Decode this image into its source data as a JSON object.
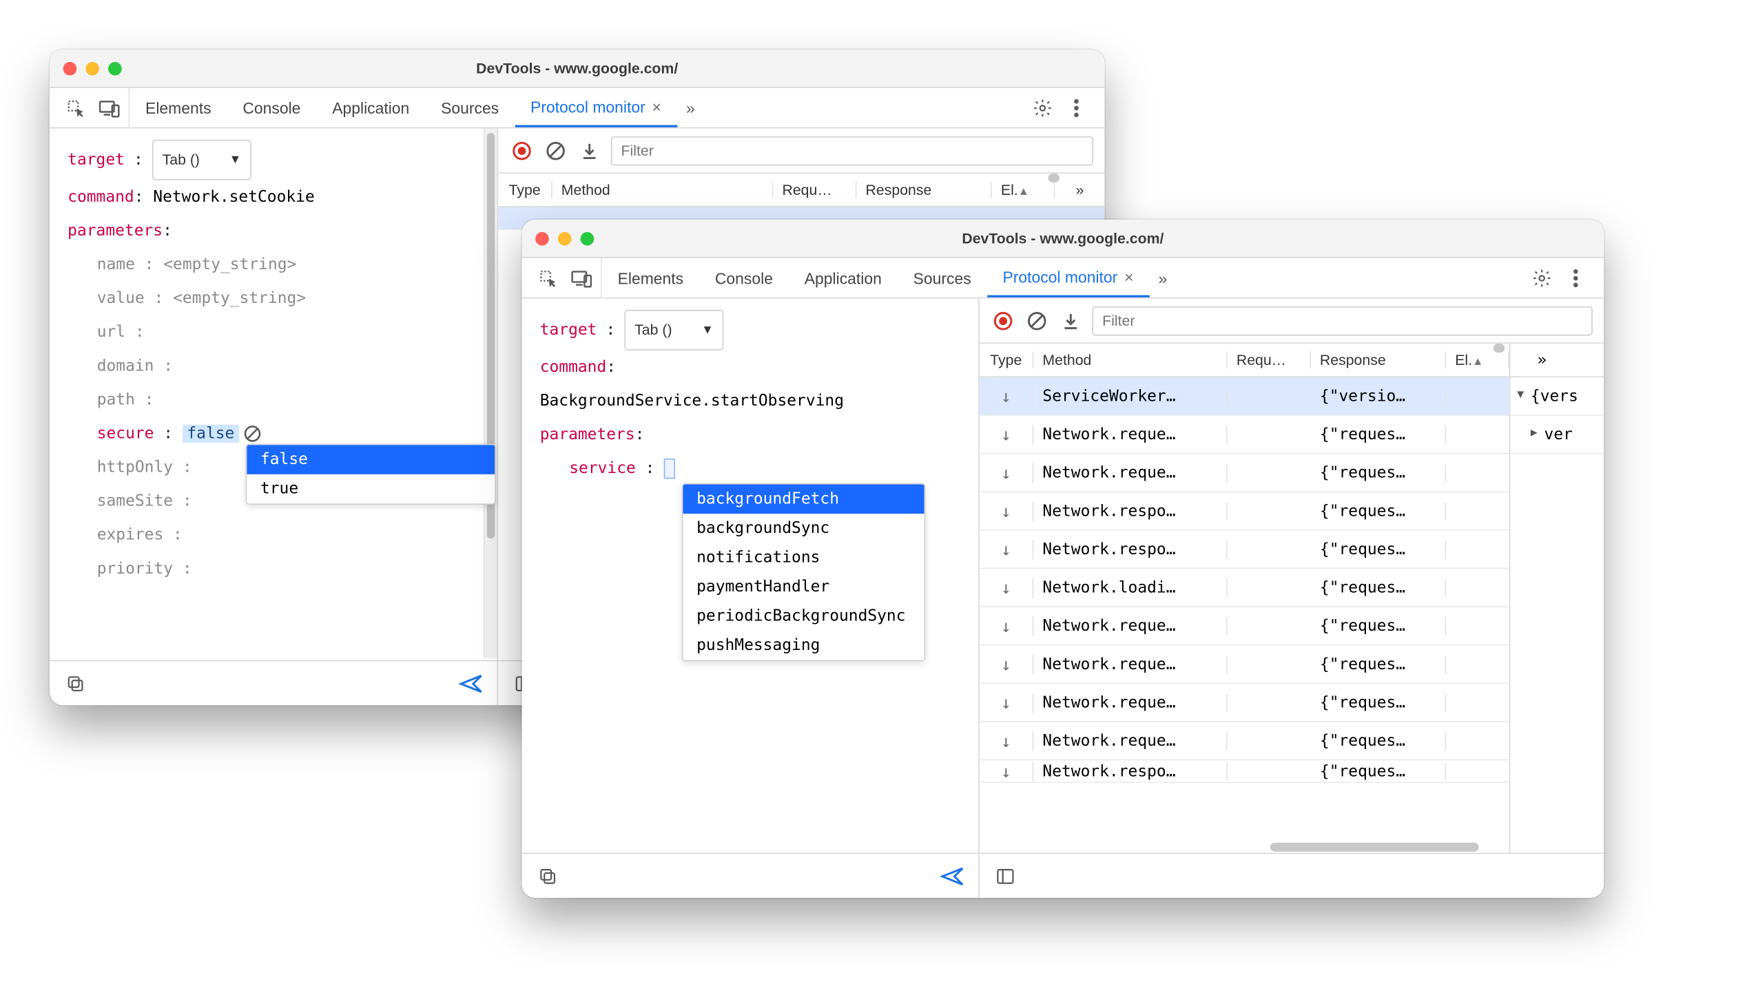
{
  "windowA": {
    "title": "DevTools - www.google.com/",
    "tabs": [
      "Elements",
      "Console",
      "Application",
      "Sources",
      "Protocol monitor"
    ],
    "activeTab": 4,
    "target": {
      "label": "target",
      "selectValue": "Tab ()"
    },
    "commandLabel": "command",
    "commandValue": "Network.setCookie",
    "parametersLabel": "parameters",
    "params": [
      {
        "name": "name",
        "value": "<empty_string>",
        "grey": true
      },
      {
        "name": "value",
        "value": "<empty_string>",
        "grey": true
      },
      {
        "name": "url",
        "value": "",
        "grey": true
      },
      {
        "name": "domain",
        "value": "",
        "grey": true
      },
      {
        "name": "path",
        "value": "",
        "grey": true
      },
      {
        "name": "secure",
        "value": "false",
        "selected": true
      },
      {
        "name": "httpOnly",
        "value": "",
        "grey": true
      },
      {
        "name": "sameSite",
        "value": "",
        "grey": true
      },
      {
        "name": "expires",
        "value": "",
        "grey": true
      },
      {
        "name": "priority",
        "value": "",
        "grey": true
      }
    ],
    "secureDropdown": [
      "false",
      "true"
    ],
    "filterPlaceholder": "Filter",
    "tableHeaders": {
      "type": "Type",
      "method": "Method",
      "req": "Requ…",
      "resp": "Response",
      "el": "El.",
      "more": "»"
    }
  },
  "windowB": {
    "title": "DevTools - www.google.com/",
    "tabs": [
      "Elements",
      "Console",
      "Application",
      "Sources",
      "Protocol monitor"
    ],
    "activeTab": 4,
    "target": {
      "label": "target",
      "selectValue": "Tab ()"
    },
    "commandLabel": "command",
    "commandValue": "BackgroundService.startObserving",
    "parametersLabel": "parameters",
    "serviceKey": "service",
    "serviceDropdown": [
      "backgroundFetch",
      "backgroundSync",
      "notifications",
      "paymentHandler",
      "periodicBackgroundSync",
      "pushMessaging"
    ],
    "filterPlaceholder": "Filter",
    "tableHeaders": {
      "type": "Type",
      "method": "Method",
      "req": "Requ…",
      "resp": "Response",
      "el": "El.",
      "more": "»"
    },
    "rows": [
      {
        "method": "ServiceWorker…",
        "resp": "{\"versio…",
        "hl": true
      },
      {
        "method": "Network.reque…",
        "resp": "{\"reques…"
      },
      {
        "method": "Network.reque…",
        "resp": "{\"reques…"
      },
      {
        "method": "Network.respo…",
        "resp": "{\"reques…"
      },
      {
        "method": "Network.respo…",
        "resp": "{\"reques…"
      },
      {
        "method": "Network.loadi…",
        "resp": "{\"reques…"
      },
      {
        "method": "Network.reque…",
        "resp": "{\"reques…"
      },
      {
        "method": "Network.reque…",
        "resp": "{\"reques…"
      },
      {
        "method": "Network.reque…",
        "resp": "{\"reques…"
      },
      {
        "method": "Network.reque…",
        "resp": "{\"reques…"
      },
      {
        "method": "Network.respo…",
        "resp": "{\"reques…",
        "cut": true
      }
    ],
    "side": {
      "root": "{vers",
      "child": "ver"
    }
  },
  "icons": {
    "overflow": "»"
  }
}
